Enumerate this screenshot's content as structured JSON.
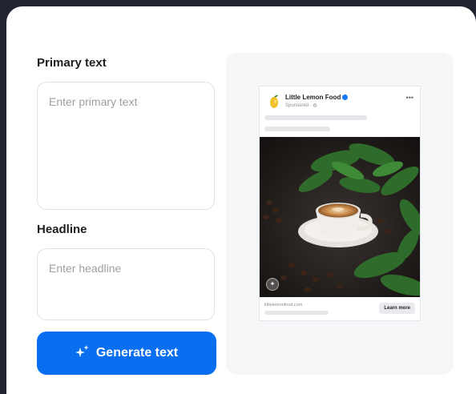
{
  "form": {
    "primary_text": {
      "label": "Primary text",
      "placeholder": "Enter primary text",
      "value": ""
    },
    "headline": {
      "label": "Headline",
      "placeholder": "Enter headline",
      "value": ""
    },
    "generate_button": {
      "label": "Generate text",
      "icon": "sparkle-icon"
    }
  },
  "preview": {
    "page_name": "Little Lemon Food",
    "sponsored": "Sponsored · ",
    "more_icon": "more-icon",
    "image_description_icon": "ai-image-badge-icon",
    "url": "littlelemonfood.com",
    "cta_label": "Learn more"
  },
  "colors": {
    "primary_button": "#0a6ef0",
    "background": "#1f2430",
    "panel": "#f5f6f7",
    "verified": "#1877f2"
  }
}
